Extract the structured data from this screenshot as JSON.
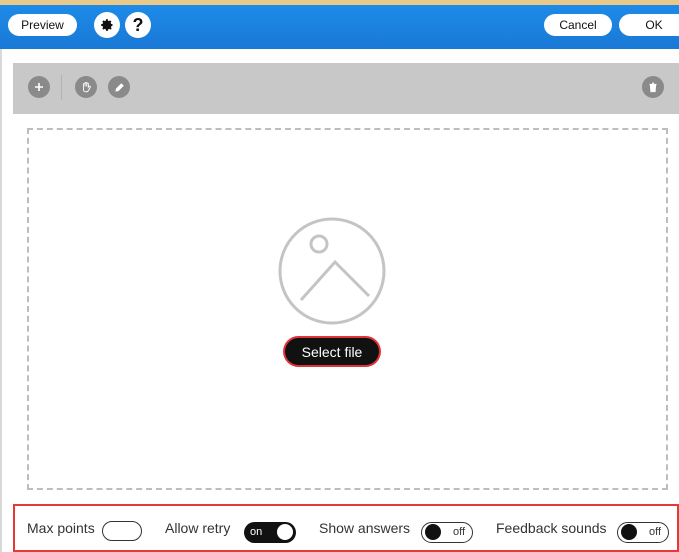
{
  "header": {
    "preview_label": "Preview",
    "settings_icon": "gear-icon",
    "help_label": "?",
    "cancel_label": "Cancel",
    "ok_label": "OK"
  },
  "toolbar": {
    "icons": [
      "plus-icon",
      "hand-icon",
      "pencil-icon",
      "trash-icon"
    ]
  },
  "dropzone": {
    "image_icon": "image-placeholder-icon",
    "select_file_label": "Select file"
  },
  "settings": {
    "max_points": {
      "label": "Max points",
      "value": ""
    },
    "allow_retry": {
      "label": "Allow retry",
      "state": "on"
    },
    "show_answers": {
      "label": "Show answers",
      "state": "off"
    },
    "feedback_sounds": {
      "label": "Feedback sounds",
      "state": "off"
    }
  },
  "colors": {
    "header": "#1a78d6",
    "toolbar": "#c8c8c8",
    "highlight": "#e53935"
  }
}
